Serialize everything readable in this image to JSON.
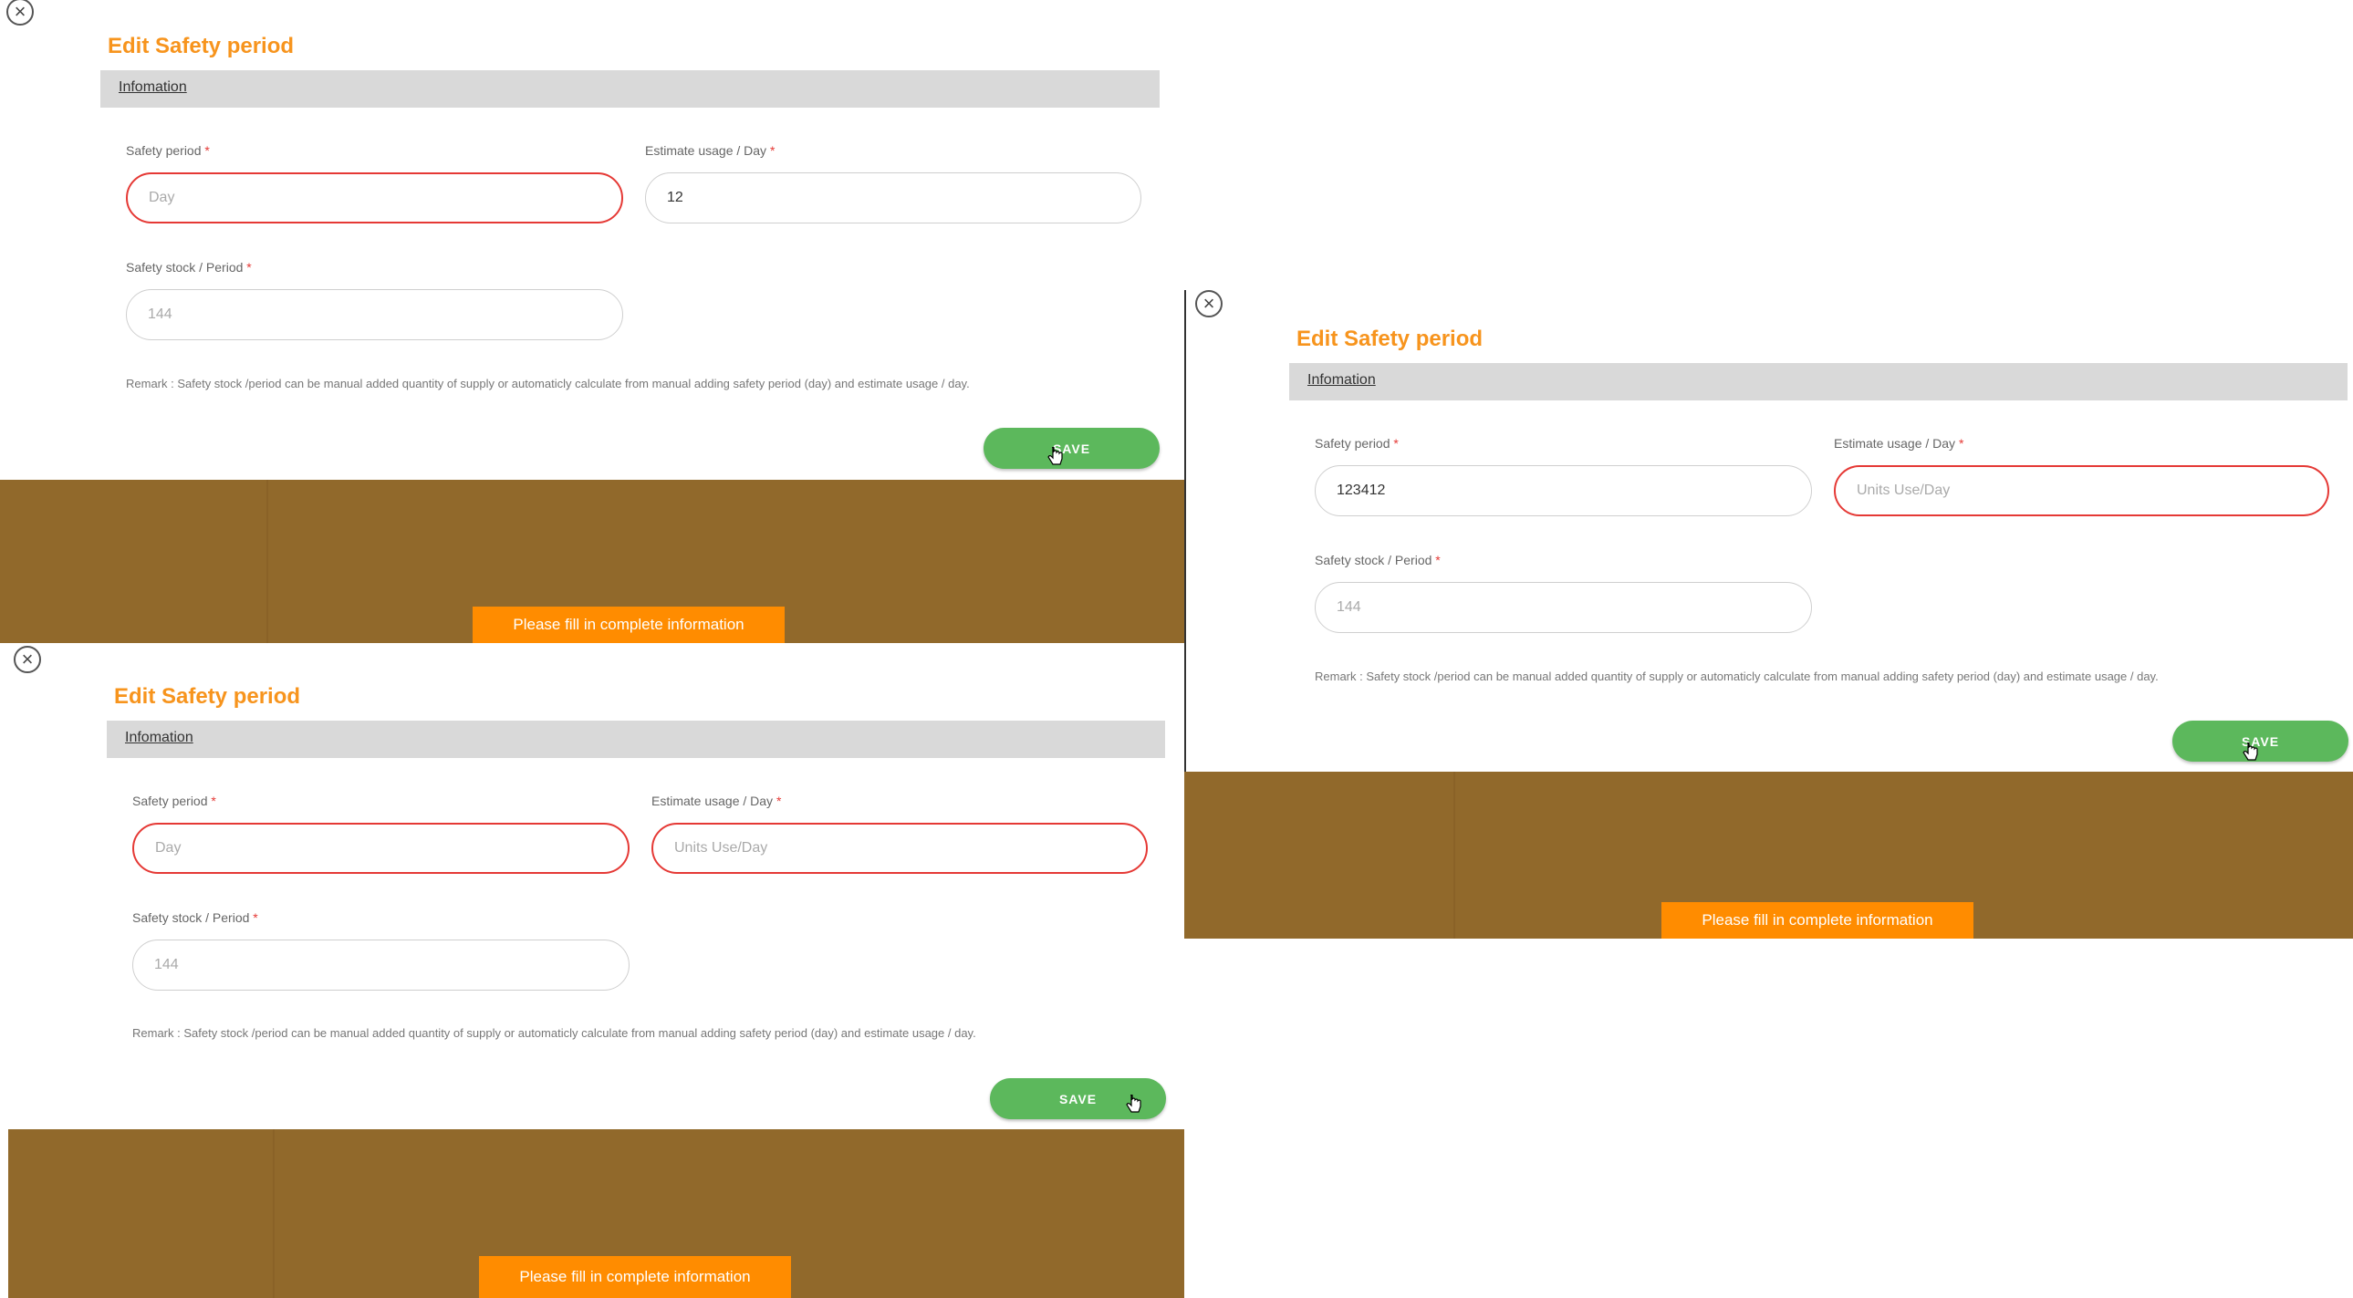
{
  "toast_text": "Please fill in complete information",
  "dialogs": [
    {
      "title": "Edit Safety period",
      "tab": "Infomation",
      "close_icon": "close-circle-icon",
      "safety_period_label": "Safety period",
      "estimate_label": "Estimate usage / Day",
      "stock_label": "Safety stock / Period",
      "required_mark": "*",
      "safety_period_placeholder": "Day",
      "safety_period_value": "",
      "estimate_placeholder": "",
      "estimate_value": "12",
      "stock_placeholder": "144",
      "remark": "Remark : Safety stock /period can be manual added quantity of supply or automaticly calculate from manual adding safety period (day) and estimate usage / day.",
      "save_label": "SAVE"
    },
    {
      "title": "Edit Safety period",
      "tab": "Infomation",
      "close_icon": "close-circle-icon",
      "safety_period_label": "Safety period",
      "estimate_label": "Estimate usage / Day",
      "stock_label": "Safety stock / Period",
      "required_mark": "*",
      "safety_period_placeholder": "",
      "safety_period_value": "123412",
      "estimate_placeholder": "Units Use/Day",
      "estimate_value": "",
      "stock_placeholder": "144",
      "remark": "Remark : Safety stock /period can be manual added quantity of supply or automaticly calculate from manual adding safety period (day) and estimate usage / day.",
      "save_label": "SAVE"
    },
    {
      "title": "Edit Safety period",
      "tab": "Infomation",
      "close_icon": "close-circle-icon",
      "safety_period_label": "Safety period",
      "estimate_label": "Estimate usage / Day",
      "stock_label": "Safety stock / Period",
      "required_mark": "*",
      "safety_period_placeholder": "Day",
      "safety_period_value": "",
      "estimate_placeholder": "Units Use/Day",
      "estimate_value": "",
      "stock_placeholder": "144",
      "remark": "Remark : Safety stock /period can be manual added quantity of supply or automaticly calculate from manual adding safety period (day) and estimate usage / day.",
      "save_label": "SAVE"
    }
  ],
  "colors": {
    "title": "#f7941d",
    "save": "#5cb85c",
    "error_border": "#e53935",
    "toast": "#ff8c00",
    "backdrop": "#91692b"
  }
}
